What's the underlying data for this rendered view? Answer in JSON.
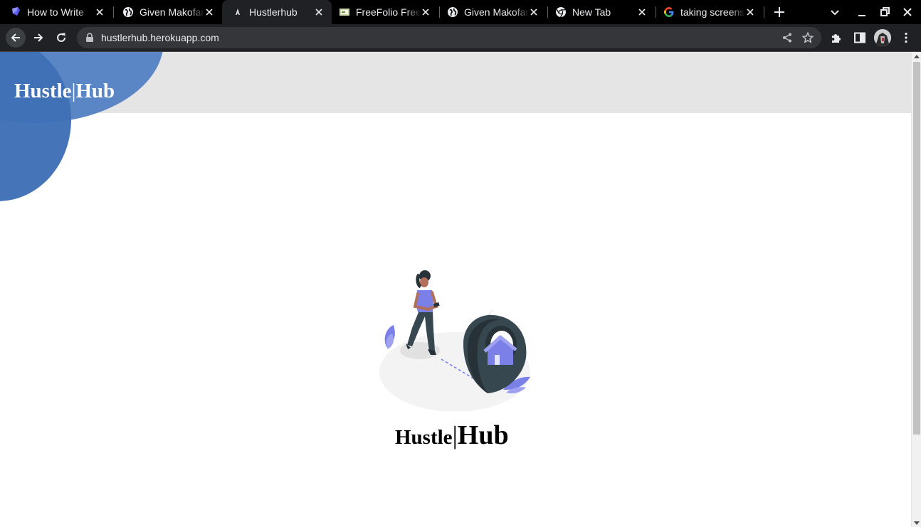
{
  "browser": {
    "tabs": [
      {
        "title": "How to Write",
        "icon": "hashnode-icon",
        "active": false
      },
      {
        "title": "Given Makofane",
        "icon": "globe-icon",
        "active": false
      },
      {
        "title": "Hustlerhub",
        "icon": "angular-icon",
        "active": true
      },
      {
        "title": "FreeFolio Free",
        "icon": "image-favicon-icon",
        "active": false
      },
      {
        "title": "Given Makofane",
        "icon": "globe-icon",
        "active": false
      },
      {
        "title": "New Tab",
        "icon": "chrome-icon",
        "active": false
      },
      {
        "title": "taking screenshot",
        "icon": "google-icon",
        "active": false
      }
    ],
    "address": "hustlerhub.herokuapp.com"
  },
  "page": {
    "brand_left": "Hustle",
    "brand_sep": "|",
    "brand_right": "Hub",
    "hero_left": "Hustle",
    "hero_sep": "|",
    "hero_right": "Hub"
  },
  "colors": {
    "header_bg": "#e5e5e5",
    "circle_light": "#5a86c6",
    "circle_dark": "#3f71b6",
    "illustration_accent": "#7b7fe8",
    "pin_dark": "#37474f"
  }
}
